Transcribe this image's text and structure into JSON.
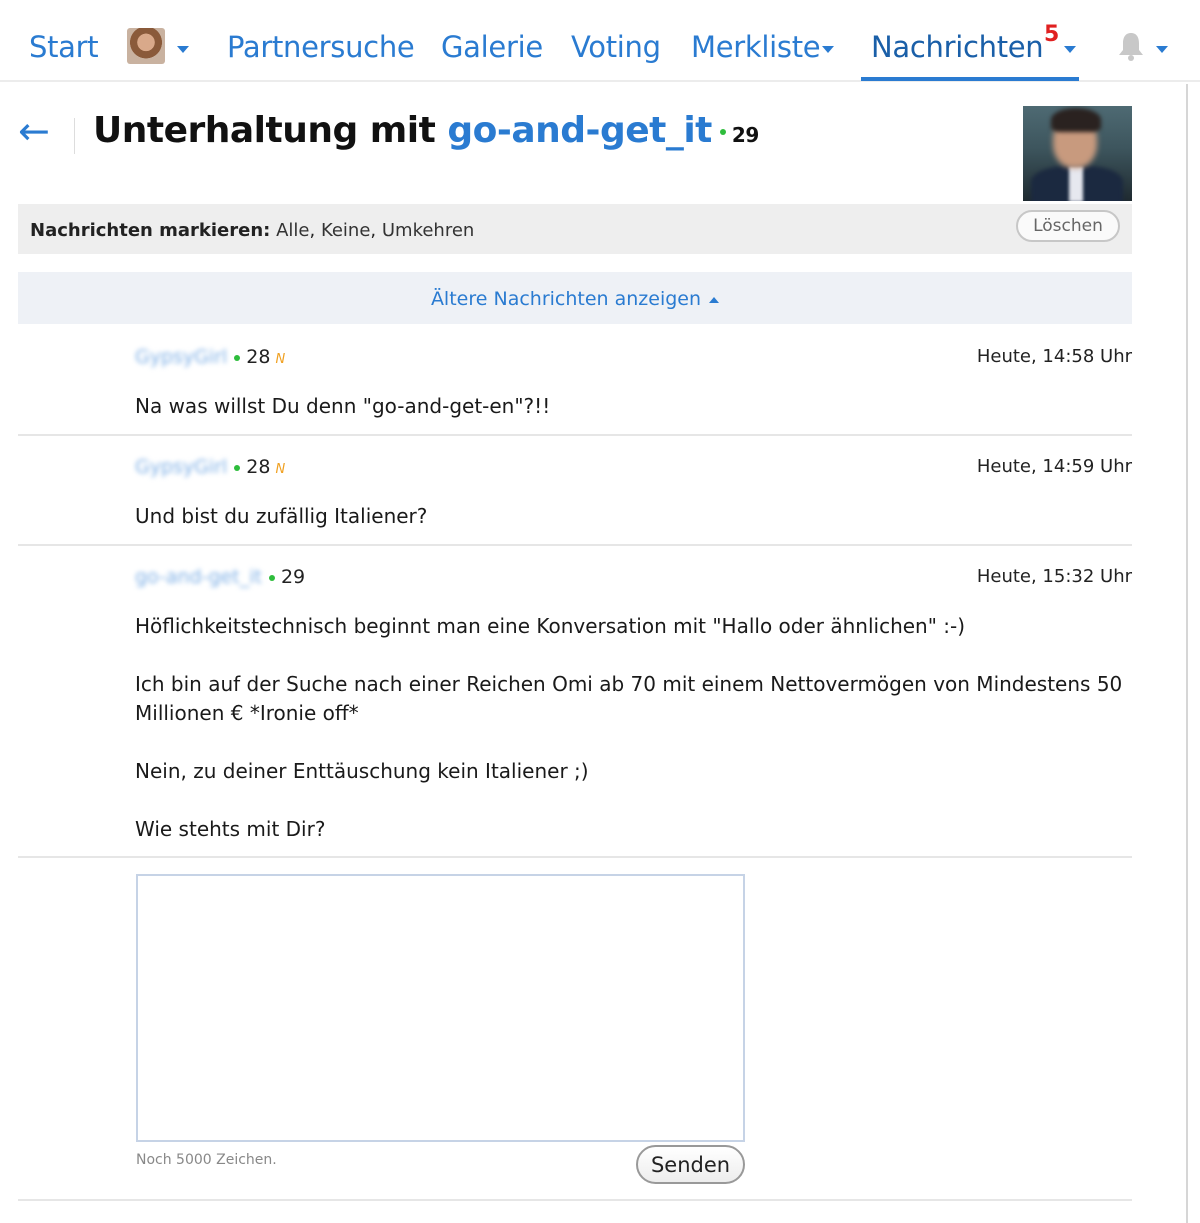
{
  "nav": {
    "start": "Start",
    "partnersuche": "Partnersuche",
    "galerie": "Galerie",
    "voting": "Voting",
    "merkliste": "Merkliste",
    "nachrichten": "Nachrichten",
    "nachrichten_badge": "5"
  },
  "header": {
    "back_icon": "←",
    "title_prefix": "Unterhaltung mit ",
    "partner_name": "go-and-get_it",
    "partner_age": "29"
  },
  "mark_bar": {
    "label": "Nachrichten markieren:",
    "all": "Alle",
    "none": "Keine",
    "invert": "Umkehren",
    "delete": "Löschen"
  },
  "older": {
    "label": "Ältere Nachrichten anzeigen"
  },
  "messages": [
    {
      "sender": "GypsyGirl",
      "age": "28",
      "new_flag": "N",
      "time": "Heute, 14:58 Uhr",
      "text": "Na was willst Du denn \"go-and-get-en\"?!!"
    },
    {
      "sender": "GypsyGirl",
      "age": "28",
      "new_flag": "N",
      "time": "Heute, 14:59 Uhr",
      "text": "Und bist du zufällig Italiener?"
    },
    {
      "sender": "go-and-get_it",
      "age": "29",
      "time": "Heute, 15:32 Uhr",
      "text": "Höflichkeitstechnisch beginnt man eine Konversation mit \"Hallo oder ähnlichen\" :-)\n\nIch bin auf der Suche nach einer Reichen Omi ab 70 mit einem Nettovermögen von Mindestens 50 Millionen € *Ironie off*\n\nNein, zu deiner Enttäuschung kein Italiener ;)\n\nWie stehts mit Dir?"
    }
  ],
  "compose": {
    "value": "",
    "char_count": "Noch 5000 Zeichen.",
    "send": "Senden"
  },
  "colors": {
    "link": "#2a7bd1",
    "badge": "#e02020",
    "online": "#2ebd3c",
    "new_flag": "#f0a020"
  },
  "icons": {
    "back": "back-arrow-icon",
    "notifications": "bell-icon",
    "dropdown": "chevron-down-icon"
  }
}
